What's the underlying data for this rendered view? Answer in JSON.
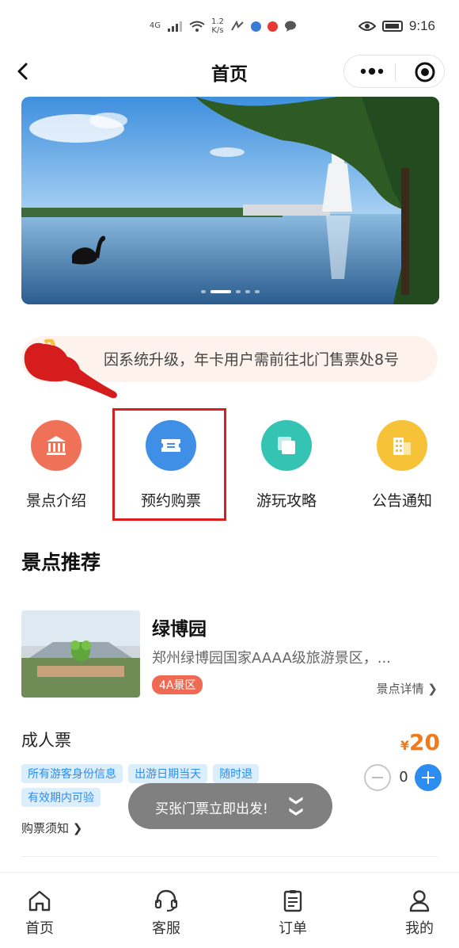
{
  "status_bar": {
    "network": "4G",
    "speed": "1.2\nK/s",
    "time": "9:16"
  },
  "nav": {
    "title": "首页"
  },
  "banner": {
    "slides": 5,
    "active_slide": 2
  },
  "notice": {
    "text": "因系统升级，年卡用户需前往北门售票处8号"
  },
  "quick_menu": [
    {
      "label": "景点介绍",
      "icon": "museum-icon",
      "color": "#ef7258"
    },
    {
      "label": "预约购票",
      "icon": "ticket-icon",
      "color": "#3f8fe6"
    },
    {
      "label": "游玩攻略",
      "icon": "copy-icon",
      "color": "#35c4b3"
    },
    {
      "label": "公告通知",
      "icon": "building-icon",
      "color": "#f6c338"
    }
  ],
  "section": {
    "title": "景点推荐"
  },
  "spot": {
    "name": "绿博园",
    "description": "郑州绿博园国家AAAA级旅游景区，...",
    "tag": "4A景区",
    "detail_link": "景点详情 ❯"
  },
  "ticket": {
    "name": "成人票",
    "currency": "¥",
    "price": "20",
    "tags": [
      "所有游客身份信息",
      "出游日期当天",
      "随时退",
      "有效期内可验"
    ],
    "quantity": "0",
    "notes_link": "购票须知 ❯"
  },
  "toast": {
    "text": "买张门票立即出发!",
    "chevron": "❯❯"
  },
  "tab_bar": [
    {
      "label": "首页",
      "icon": "home-icon"
    },
    {
      "label": "客服",
      "icon": "headset-icon"
    },
    {
      "label": "订单",
      "icon": "clipboard-icon"
    },
    {
      "label": "我的",
      "icon": "user-icon"
    }
  ],
  "colors": {
    "accent_blue": "#2d8cf0",
    "price_orange": "#f07a19",
    "tag_red": "#f06a53",
    "highlight_red": "#d81e1e"
  }
}
